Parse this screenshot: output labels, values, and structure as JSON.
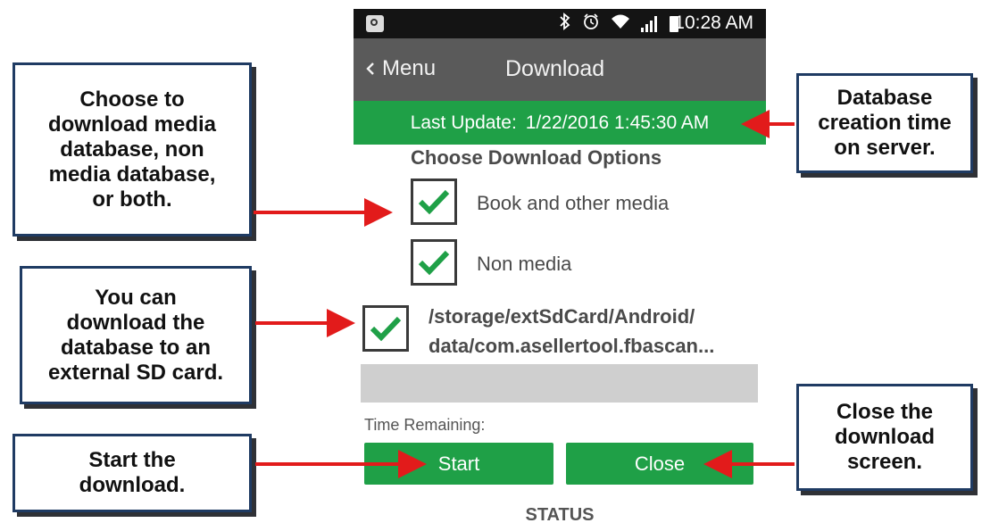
{
  "phone": {
    "status_bar": {
      "time": "10:28 AM",
      "icons": [
        "app-icon",
        "bluetooth-icon",
        "alarm-icon",
        "wifi-icon",
        "signal-icon",
        "battery-icon"
      ]
    },
    "title_bar": {
      "back_label": "Menu",
      "title": "Download"
    },
    "last_update": {
      "label": "Last Update:",
      "value": "1/22/2016 1:45:30 AM"
    },
    "options": {
      "heading": "Choose Download Options",
      "items": [
        {
          "label": "Book and other media",
          "checked": true
        },
        {
          "label": "Non media",
          "checked": true
        }
      ]
    },
    "storage": {
      "checked": true,
      "path_line1": "/storage/extSdCard/Android/",
      "path_line2": "data/com.asellertool.fbascan..."
    },
    "progress": 0,
    "time_remaining_label": "Time Remaining:",
    "buttons": {
      "start": "Start",
      "close": "Close"
    },
    "status_label": "STATUS"
  },
  "callouts": {
    "choose": [
      "Choose to",
      "download media",
      "database, non",
      "media database,",
      "or both."
    ],
    "sdcard": [
      "You can",
      "download the",
      "database to an",
      "external SD card."
    ],
    "start": [
      "Start the",
      "download."
    ],
    "database": [
      "Database",
      "creation time",
      "on server."
    ],
    "close": [
      "Close the",
      "download",
      "screen."
    ]
  },
  "colors": {
    "accent_green": "#1fa047",
    "title_bar": "#5a5a5a",
    "status_bar": "#141414",
    "arrow_red": "#e21b1b",
    "callout_border": "#1f3b63"
  }
}
